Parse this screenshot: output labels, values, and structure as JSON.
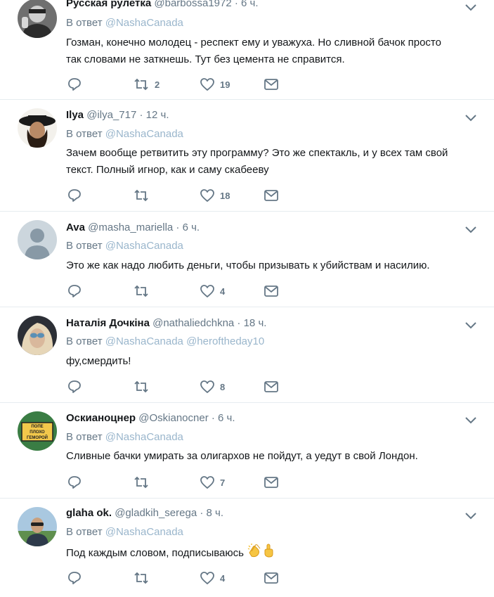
{
  "reply_prefix": "В ответ",
  "tweets": [
    {
      "name": "Русская рулетка",
      "handle": "@barbossa1972",
      "time": "6 ч.",
      "mentions": [
        "@NashaCanada"
      ],
      "text_lines": [
        "Гозман, конечно молодец - респект ему и уважуха. Но сливной бачок просто",
        "так словами не заткнешь. Тут без цемента не справится."
      ],
      "retweets": "2",
      "likes": "19"
    },
    {
      "name": "Ilya",
      "handle": "@ilya_717",
      "time": "12 ч.",
      "mentions": [
        "@NashaCanada"
      ],
      "text_lines": [
        "Зачем вообще ретвитить эту программу? Это же спектакль, и у всех там свой",
        "текст. Полный игнор, как и саму скабееву"
      ],
      "retweets": "",
      "likes": "18"
    },
    {
      "name": "Ava",
      "handle": "@masha_mariella",
      "time": "6 ч.",
      "mentions": [
        "@NashaCanada"
      ],
      "text_lines": [
        "Это же как надо любить деньги, чтобы призывать к убийствам и насилию."
      ],
      "retweets": "",
      "likes": "4"
    },
    {
      "name": "Наталія Дочкіна",
      "handle": "@nathaliedchkna",
      "time": "18 ч.",
      "mentions": [
        "@NashaCanada",
        "@heroftheday10"
      ],
      "text_lines": [
        "фу,смердить!"
      ],
      "retweets": "",
      "likes": "8"
    },
    {
      "name": "Оскианоцнер",
      "handle": "@Oskianocner",
      "time": "6 ч.",
      "mentions": [
        "@NashaCanada"
      ],
      "text_lines": [
        "Сливные бачки умирать за олигархов не пойдут, а уедут в свой Лондон."
      ],
      "retweets": "",
      "likes": "7",
      "avatar_sign": [
        "ПОПЕ",
        "ПЛОХО",
        "ГЕМОРОЙ"
      ]
    },
    {
      "name": "glaha ok.",
      "handle": "@gladkih_serega",
      "time": "8 ч.",
      "mentions": [
        "@NashaCanada"
      ],
      "text_lines": [
        "Под каждым словом, подписываюсь"
      ],
      "emojis": [
        "clapping-hands",
        "index-pointing-up"
      ],
      "retweets": "",
      "likes": "4"
    }
  ],
  "colors": {
    "text": "#14171a",
    "secondary": "#657786",
    "mention": "#9ab6cc",
    "divider": "#e6ecf0"
  }
}
